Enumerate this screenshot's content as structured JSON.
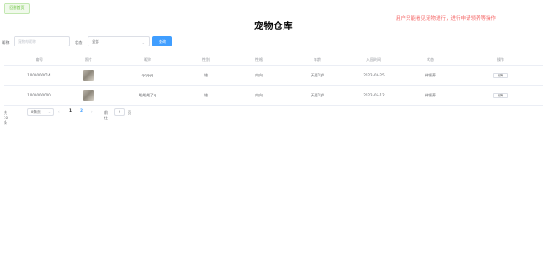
{
  "toolbar": {
    "back_label": "回到首页"
  },
  "page": {
    "title": "宠物仓库",
    "notice": "用户只能看见宠物进行，进行申请领养等操作"
  },
  "filters": {
    "name_label": "昵称",
    "name_placeholder": "宠物的昵称",
    "status_label": "状态",
    "status_value": "全部",
    "search_label": "查询"
  },
  "table": {
    "columns": [
      "编号",
      "照片",
      "昵称",
      "性别",
      "性格",
      "年龄",
      "入园时间",
      "状态",
      "操作"
    ],
    "rows": [
      {
        "id": "1000000014",
        "name": "qqqqq",
        "gender": "雄",
        "temper": "内向",
        "age": "天涯1岁",
        "date": "2022-03-25",
        "status": "待领养",
        "action": "领养"
      },
      {
        "id": "1000000000",
        "name": "啦啦啦了q",
        "gender": "雄",
        "temper": "内向",
        "age": "天涯1岁",
        "date": "2022-05-12",
        "status": "待领养",
        "action": "领养"
      }
    ]
  },
  "pagination": {
    "total": "共 10 条",
    "page_size": "8条/页",
    "prev": "‹",
    "pages": [
      "1",
      "2"
    ],
    "next": "›",
    "goto_label": "前往",
    "goto_value": "2",
    "goto_suffix": "页"
  },
  "colors": {
    "primary": "#409eff",
    "success": "#67c23a",
    "danger": "#f56c6c"
  }
}
